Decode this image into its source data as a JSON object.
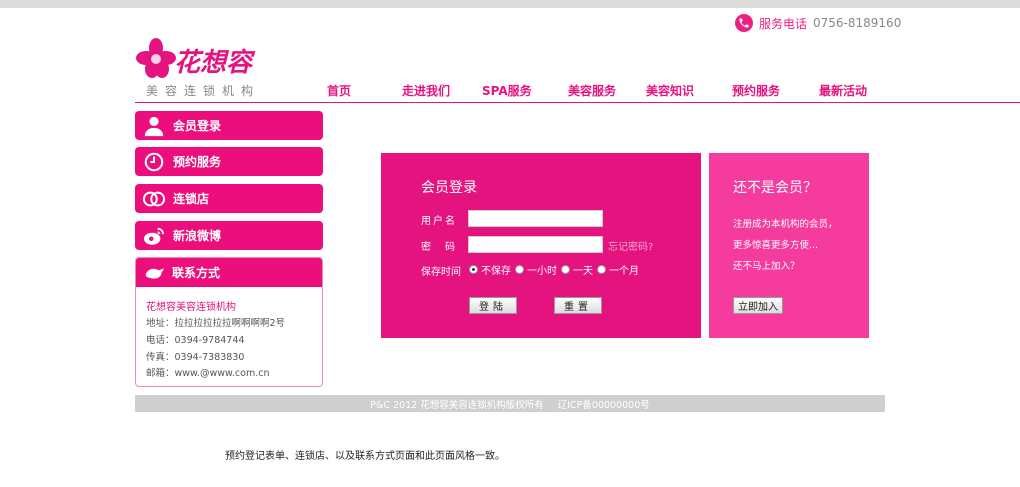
{
  "header": {
    "hotline_label": "服务电话",
    "hotline_number": "0756-8189160",
    "logo_text": "花想容",
    "tagline": "美容连锁机构"
  },
  "nav": {
    "items": [
      "首页",
      "走进我们",
      "SPA服务",
      "美容服务",
      "美容知识",
      "预约服务",
      "最新活动"
    ]
  },
  "sidebar": {
    "items": [
      "会员登录",
      "预约服务",
      "连锁店",
      "新浪微博"
    ],
    "contact_title": "联系方式",
    "company": "花想容美容连锁机构",
    "address": "地址：拉拉拉拉拉拉啊啊啊啊2号",
    "phone": "电话：0394-9784744",
    "fax": "传真：0394-7383830",
    "email": "邮箱：www.@www.com.cn"
  },
  "login": {
    "title": "会员登录",
    "username_label": "用户名",
    "password_label": "密　码",
    "username_value": "",
    "password_value": "",
    "forgot": "忘记密码?",
    "remember_label": "保存时间",
    "remember_options": [
      "不保存",
      "一小时",
      "一天",
      "一个月"
    ],
    "remember_selected": "不保存",
    "login_button": "登陆",
    "reset_button": "重置"
  },
  "join": {
    "title": "还不是会员？",
    "line1": "注册成为本机构的会员，",
    "line2": "更多惊喜更多方便...",
    "line3": "还不马上加入？",
    "button": "立即加入"
  },
  "footer": {
    "copyright": "P&C 2012 花想容美容连锁机构版权所有",
    "icp": "辽ICP备00000000号"
  },
  "note": "预约登记表单、连锁店、以及联系方式页面和此页面风格一致。",
  "colors": {
    "brand": "#e5137f",
    "join_panel": "#f53c9e",
    "footer": "#cfcfcf"
  },
  "icons": {
    "hotline": "phone-icon",
    "member": "user-icon",
    "booking": "clock-icon",
    "chain": "rings-icon",
    "weibo": "weibo-icon",
    "contact": "bird-icon"
  }
}
